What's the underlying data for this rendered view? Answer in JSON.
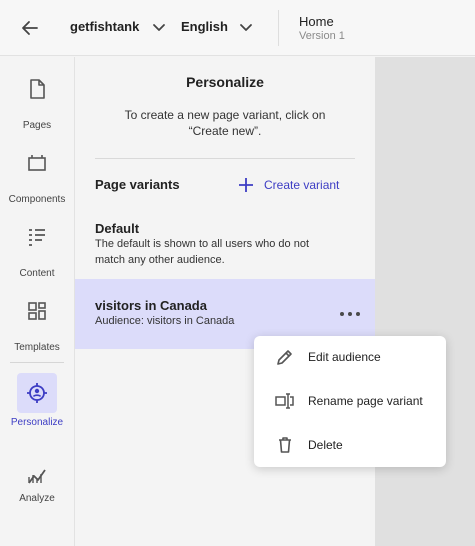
{
  "topbar": {
    "site": "getfishtank",
    "language": "English",
    "page_name": "Home",
    "page_version": "Version 1"
  },
  "nav": [
    {
      "label": "Pages",
      "icon": "page-icon"
    },
    {
      "label": "Components",
      "icon": "components-icon"
    },
    {
      "label": "Content",
      "icon": "content-icon"
    },
    {
      "label": "Templates",
      "icon": "templates-icon"
    },
    {
      "label": "Personalize",
      "icon": "personalize-icon",
      "active": true
    },
    {
      "label": "Analyze",
      "icon": "analyze-icon"
    }
  ],
  "panel": {
    "title": "Personalize",
    "hint": "To create a new page variant, click on “Create new”.",
    "section_title": "Page variants",
    "create_label": "Create variant",
    "variants": [
      {
        "name": "Default",
        "description": "The default is shown to all users who do not match any other audience."
      },
      {
        "name": "visitors in Canada",
        "description": "Audience: visitors in Canada"
      }
    ]
  },
  "menu": [
    {
      "label": "Edit audience",
      "icon": "pencil-icon"
    },
    {
      "label": "Rename page variant",
      "icon": "rename-icon"
    },
    {
      "label": "Delete",
      "icon": "trash-icon"
    }
  ],
  "colors": {
    "accent": "#3d3dc4",
    "selected_bg": "#dcdcfa",
    "canvas": "#e0e0e0"
  }
}
